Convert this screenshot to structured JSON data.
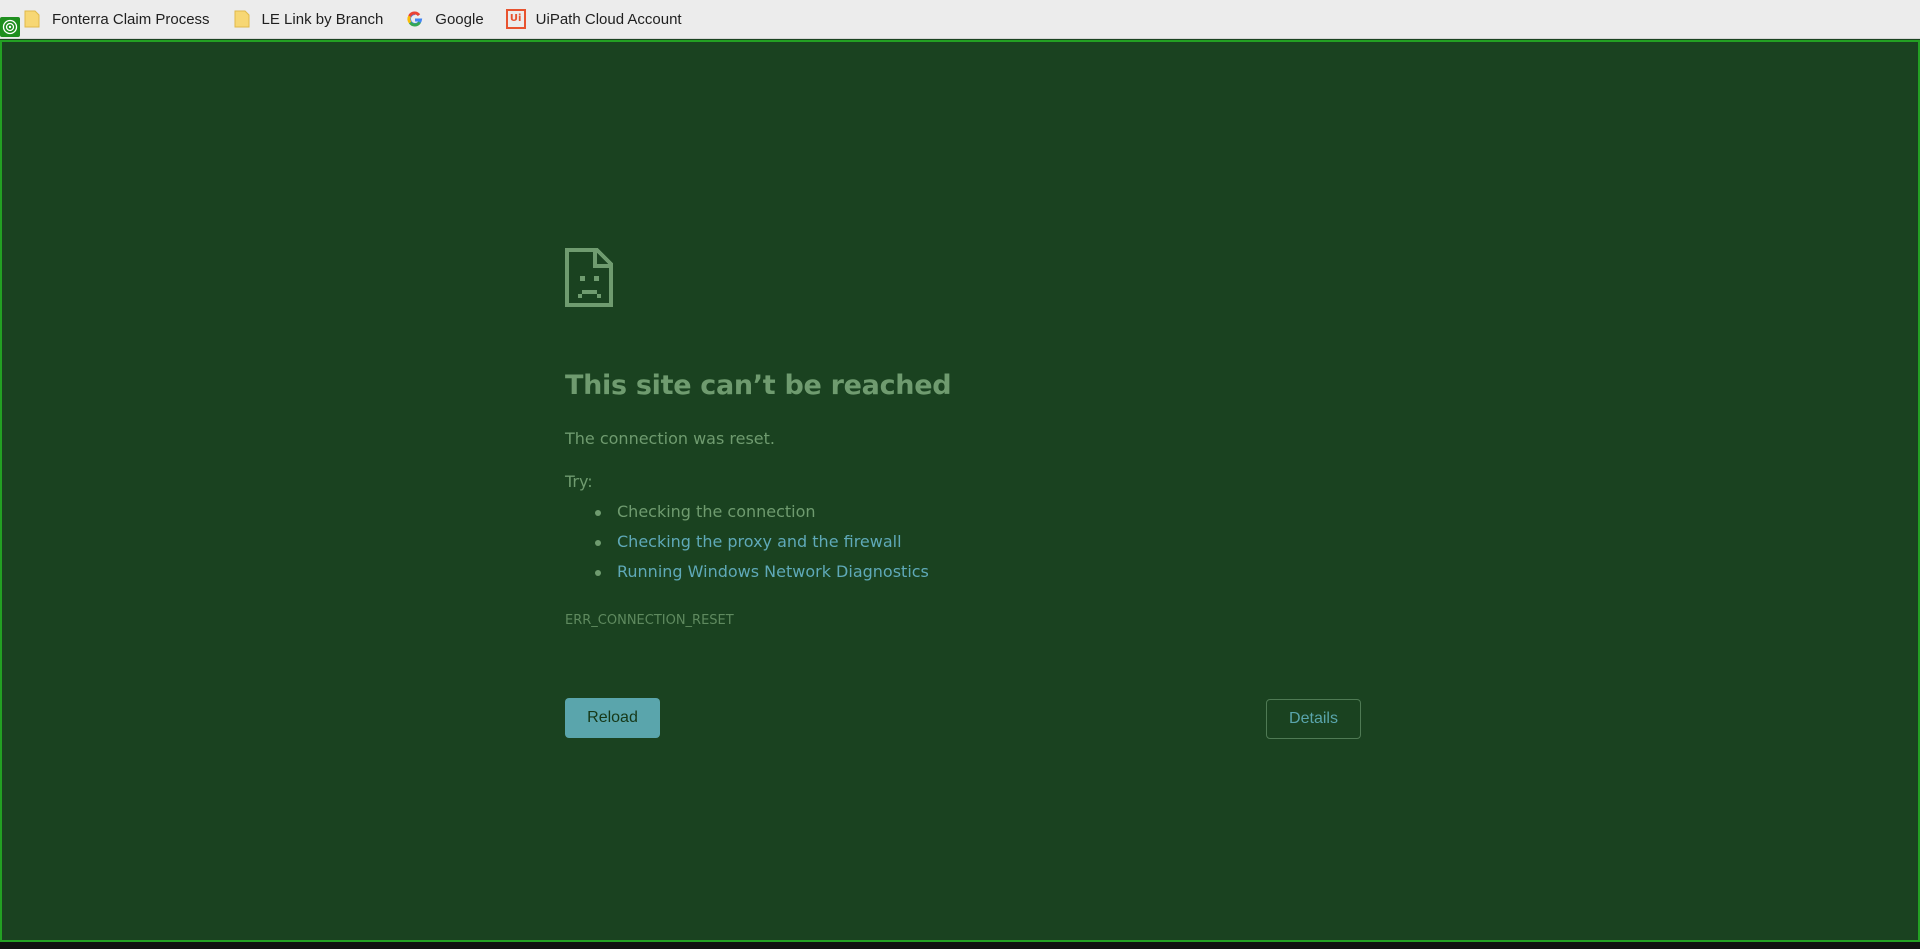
{
  "bookmarks": [
    {
      "label": "Fonterra Claim Process",
      "icon": "folder-icon"
    },
    {
      "label": "LE Link by Branch",
      "icon": "folder-icon"
    },
    {
      "label": "Google",
      "icon": "google-icon"
    },
    {
      "label": "UiPath Cloud Account",
      "icon": "uipath-icon"
    }
  ],
  "uipath_icon_text": "Ui",
  "error": {
    "icon": "sad-document-icon",
    "title": "This site can’t be reached",
    "message": "The connection was reset.",
    "try_label": "Try:",
    "suggestions": [
      "Checking the connection",
      "Checking the proxy and the firewall",
      "Running Windows Network Diagnostics"
    ],
    "code": "ERR_CONNECTION_RESET"
  },
  "buttons": {
    "reload": "Reload",
    "details": "Details"
  },
  "colors": {
    "background": "#1a4220",
    "text": "#6f9b6f",
    "link": "#5fa9b8",
    "button": "#5aa5ac",
    "highlight_border": "#23a023"
  }
}
